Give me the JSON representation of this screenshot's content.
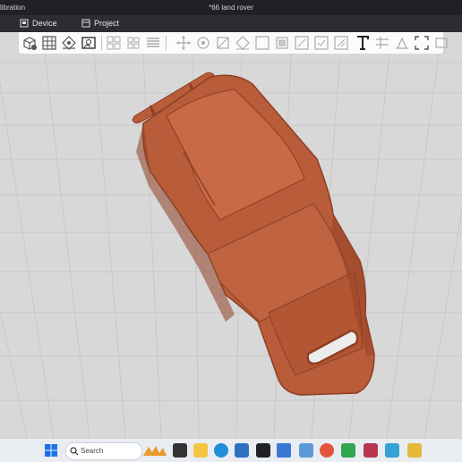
{
  "window": {
    "app_title": "libration",
    "document_title": "*66 land rover"
  },
  "menu": {
    "device_label": "Device",
    "project_label": "Project"
  },
  "toolbar": {
    "tools": [
      "add-object-icon",
      "arrange-grid-icon",
      "auto-orient-icon",
      "import-image-icon",
      "cube-view-icon",
      "multi-plate-icon",
      "layers-icon",
      "move-icon",
      "rotate-icon",
      "scale-icon",
      "mirror-icon",
      "hollow-icon",
      "cut-icon",
      "support-icon",
      "paint-icon",
      "text-icon",
      "measure-icon",
      "drop-icon",
      "fit-icon",
      "split-icon"
    ]
  },
  "taskbar": {
    "search_placeholder": "Search"
  },
  "colors": {
    "model": "#b85c3a",
    "model_shadow": "#8e3f24",
    "grid": "#c4c4c4",
    "toolbar_bg": "#fbfbfb"
  }
}
